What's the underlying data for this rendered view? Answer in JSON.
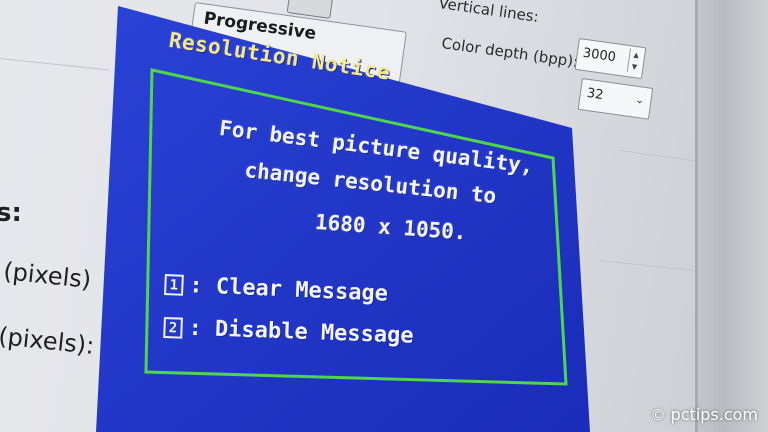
{
  "background_settings": {
    "scan_mode_value": "Progressive",
    "vertical_lines_label": "Vertical lines:",
    "vertical_lines_value": "3000",
    "color_depth_label": "Color depth (bpp):",
    "color_depth_value": "32",
    "partial_colon_label": "s:",
    "partial_pixels_label_1": "(pixels)",
    "partial_pixels_label_2": "(pixels):"
  },
  "notice": {
    "title": "Resolution Notice",
    "message_lines": [
      "For best picture quality,",
      "change resolution to",
      "1680 x 1050."
    ],
    "options": [
      {
        "key": "1",
        "label": ": Clear Message"
      },
      {
        "key": "2",
        "label": ": Disable Message"
      }
    ]
  },
  "watermark": {
    "symbol": "©",
    "text": "pctips.com"
  },
  "colors": {
    "osd_blue": "#1f35c8",
    "osd_border_green": "#4fd64a",
    "osd_title_yellow": "#f3e98a",
    "osd_text": "#f2f4ff"
  },
  "icons": {
    "dropdown": "chevron-down-icon",
    "spinner": "spinner-arrows-icon",
    "copyright": "copyright-icon"
  }
}
